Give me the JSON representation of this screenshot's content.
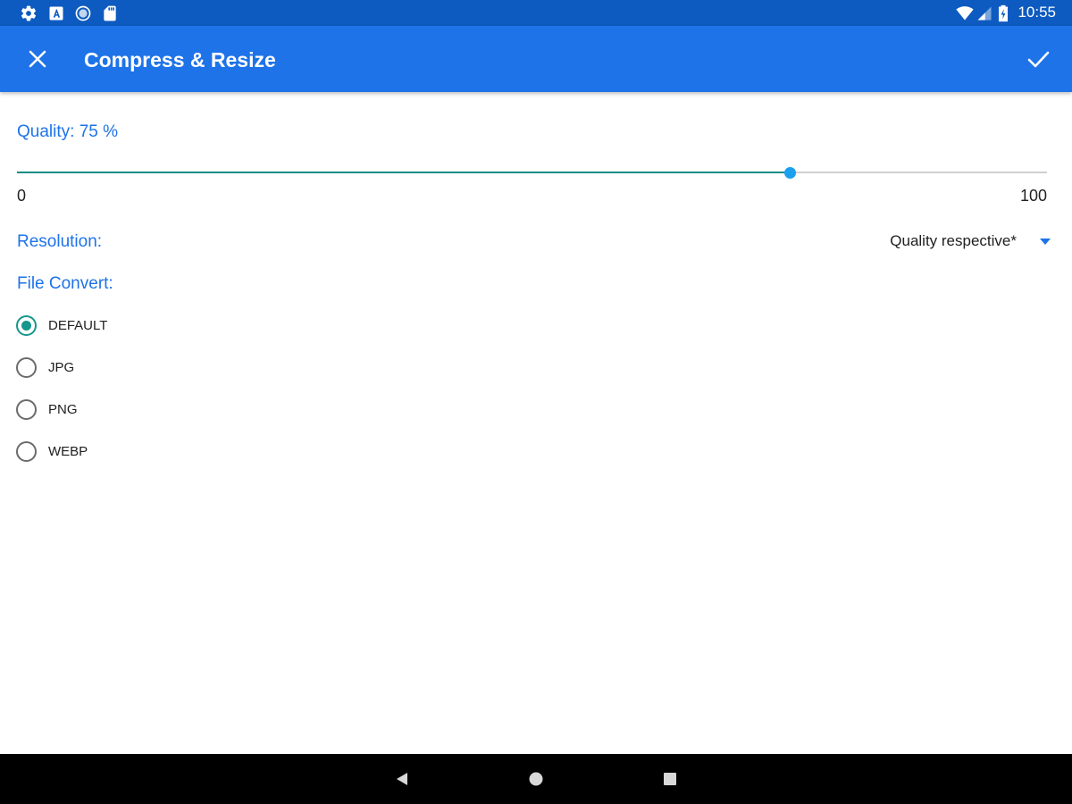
{
  "status_bar": {
    "left_icons": [
      "settings-icon",
      "keyboard-a-icon",
      "sync-circle-icon",
      "sd-card-icon"
    ],
    "right_icons": [
      "wifi-icon",
      "signal-icon",
      "battery-charging-icon"
    ],
    "time": "10:55"
  },
  "app_bar": {
    "title": "Compress & Resize",
    "close_icon": "close-icon",
    "confirm_icon": "check-icon",
    "color": "#1e73e8"
  },
  "quality": {
    "label": "Quality: 75 %",
    "value": 75,
    "min": 0,
    "max": 100,
    "min_label": "0",
    "max_label": "100"
  },
  "resolution": {
    "label": "Resolution:",
    "selected": "Quality respective*"
  },
  "file_convert": {
    "label": "File Convert:",
    "options": [
      {
        "label": "DEFAULT",
        "checked": true
      },
      {
        "label": "JPG",
        "checked": false
      },
      {
        "label": "PNG",
        "checked": false
      },
      {
        "label": "WEBP",
        "checked": false
      }
    ]
  },
  "nav_bar": {
    "icons": [
      "back-icon",
      "home-icon",
      "recents-icon"
    ]
  },
  "colors": {
    "accent": "#1e73e8",
    "status_bar": "#0d5bc0",
    "slider_fill": "#118e86",
    "slider_thumb": "#1aa0ef",
    "radio_checked": "#17968b"
  }
}
